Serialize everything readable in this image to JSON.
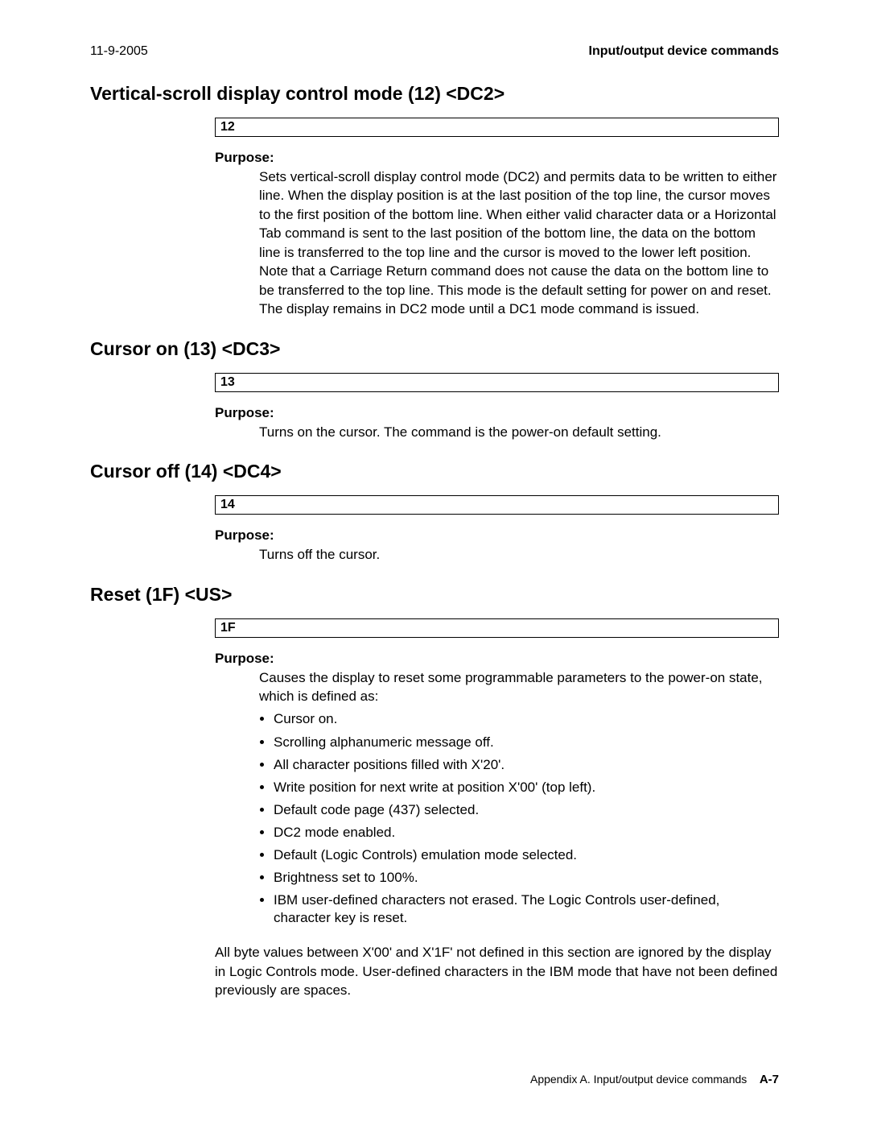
{
  "header": {
    "date": "11-9-2005",
    "section": "Input/output device commands"
  },
  "sections": {
    "dc2": {
      "heading": "Vertical-scroll display control mode (12) <DC2>",
      "code": "12",
      "purpose_label": "Purpose:",
      "purpose_text": "Sets vertical-scroll display control mode (DC2) and permits data to be written to either line. When the display position is at the last position of the top line, the cursor moves to the first position of the bottom line. When either valid character data or a Horizontal Tab command is sent to the last position of the bottom line, the data on the bottom line is transferred to the top line and the cursor is moved to the lower left position. Note that a Carriage Return command does not cause the data on the bottom line to be transferred to the top line. This mode is the default setting for power on and reset. The display remains in DC2 mode until a DC1 mode command is issued."
    },
    "dc3": {
      "heading": "Cursor on (13) <DC3>",
      "code": "13",
      "purpose_label": "Purpose:",
      "purpose_text": "Turns on the cursor. The command is the power-on default setting."
    },
    "dc4": {
      "heading": "Cursor off (14) <DC4>",
      "code": "14",
      "purpose_label": "Purpose:",
      "purpose_text": "Turns off the cursor."
    },
    "us": {
      "heading": "Reset (1F) <US>",
      "code": "1F",
      "purpose_label": "Purpose:",
      "purpose_text": "Causes the display to reset some programmable parameters to the power-on state, which is defined as:",
      "items": [
        "Cursor on.",
        "Scrolling alphanumeric message off.",
        "All character positions filled with X'20'.",
        "Write position for next write at position X'00' (top left).",
        "Default code page (437) selected.",
        "DC2 mode enabled.",
        "Default (Logic Controls) emulation mode selected.",
        "Brightness set to 100%.",
        "IBM user-defined characters not erased. The Logic Controls user-defined, character key is reset."
      ],
      "note": "All byte values between X'00' and X'1F' not defined in this section are ignored by the display in Logic Controls mode. User-defined characters in the IBM mode that have not been defined previously are spaces."
    }
  },
  "footer": {
    "appendix": "Appendix A. Input/output device commands",
    "page": "A-7"
  }
}
